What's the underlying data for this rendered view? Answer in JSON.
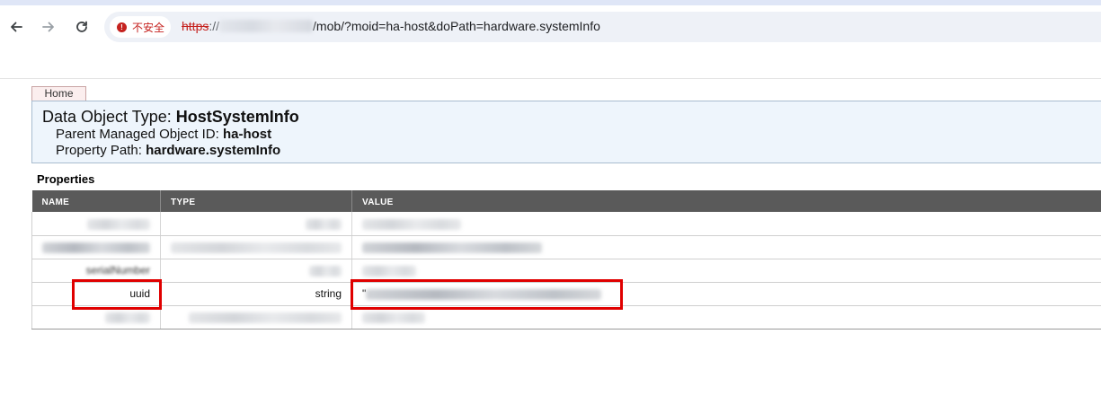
{
  "browser": {
    "security_label": "不安全",
    "url_scheme": "https",
    "url_separator": "://",
    "url_path": "/mob/?moid=ha-host&doPath=hardware.systemInfo"
  },
  "page": {
    "home_tab": "Home",
    "title_label": "Data Object Type: ",
    "title_value": "HostSystemInfo",
    "parent_label": "Parent Managed Object ID: ",
    "parent_value": "ha-host",
    "path_label": "Property Path: ",
    "path_value": "hardware.systemInfo",
    "properties_heading": "Properties"
  },
  "table": {
    "headers": [
      "NAME",
      "TYPE",
      "VALUE"
    ],
    "rows": [
      {
        "name": "",
        "type": "",
        "value": ""
      },
      {
        "name": "",
        "type": "",
        "value": ""
      },
      {
        "name": "serialNumber",
        "type": "",
        "value": ""
      },
      {
        "name": "uuid",
        "type": "string",
        "value": "\""
      },
      {
        "name": "",
        "type": "",
        "value": ""
      }
    ]
  }
}
